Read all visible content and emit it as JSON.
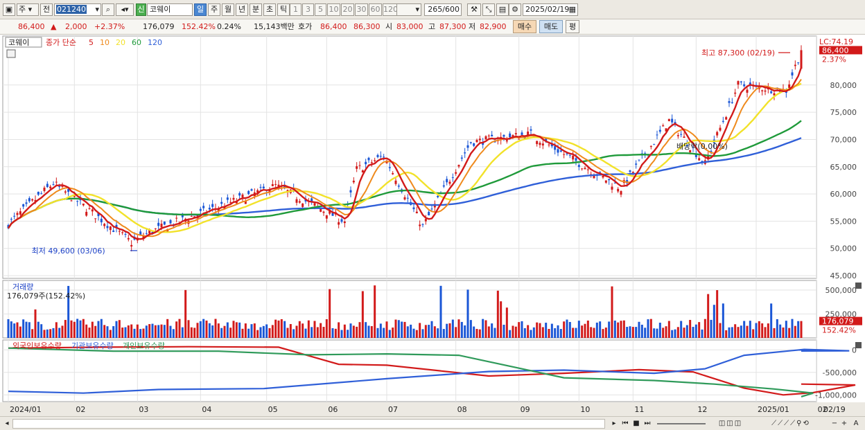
{
  "toolbar": {
    "period_unit": "주",
    "prev_label": "전",
    "stock_code": "021240",
    "market_badge": "신",
    "stock_name": "코웨이",
    "period_buttons": [
      "일",
      "주",
      "월",
      "년",
      "분",
      "초",
      "틱"
    ],
    "active_period": "일",
    "interval_buttons": [
      "1",
      "3",
      "5",
      "10",
      "20",
      "30",
      "60",
      "120"
    ],
    "count_value": "265",
    "count_max": "/600",
    "date_value": "2025/02/19"
  },
  "quote": {
    "price": "86,400",
    "change_arrow": "▲",
    "change": "2,000",
    "change_pct": "+2.37%",
    "volume": "176,079",
    "volume_ratio": "152.42%",
    "turnover": "0.24%",
    "amount": "15,143백만",
    "hoga_label": "호가",
    "ask": "86,400",
    "bid": "86,300",
    "open_label": "시",
    "open": "83,000",
    "high_label": "고",
    "high": "87,300",
    "low_label": "저",
    "low": "82,900",
    "buy_label": "매수",
    "sell_label": "매도",
    "even_label": "평"
  },
  "colors": {
    "up": "#d21a1a",
    "down": "#1a56d6",
    "ma5": "#d21a1a",
    "ma10": "#ef8a1c",
    "ma20": "#f2e22a",
    "ma60": "#1f9a3a",
    "ma120": "#2f5fd8",
    "foreign": "#d21a1a",
    "institution": "#2f5fd8",
    "individual": "#2f9a5a"
  },
  "chart_data": [
    {
      "type": "candlestick",
      "legend_stock": "코웨이",
      "legend_price": "종가 단순",
      "ma_periods": [
        "5",
        "10",
        "20",
        "60",
        "120"
      ],
      "lc_label": "LC:74.19",
      "current_price_tag": "86,400",
      "current_pct_tag": "2.37%",
      "y_ticks": [
        "80,000",
        "75,000",
        "70,000",
        "65,000",
        "60,000",
        "55,000",
        "50,000",
        "45,000"
      ],
      "y_tick_values": [
        80000,
        75000,
        70000,
        65000,
        60000,
        55000,
        50000,
        45000
      ],
      "ylim": [
        44500,
        89000
      ],
      "annotations": {
        "high": "최고 87,300 (02/19)",
        "low": "최저 49,600 (03/06)",
        "dividend": "배당락(0.00%)"
      },
      "key_points": [
        {
          "x": "2024-01-02",
          "close": 54500
        },
        {
          "x": "2024-01-26",
          "close": 62000
        },
        {
          "x": "2024-03-06",
          "low": 49600
        },
        {
          "x": "2024-03-15",
          "close": 53000
        },
        {
          "x": "2024-05-20",
          "close": 61500
        },
        {
          "x": "2024-06-25",
          "close": 55000
        },
        {
          "x": "2024-07-02",
          "close": 64500
        },
        {
          "x": "2024-07-15",
          "close": 67000
        },
        {
          "x": "2024-08-05",
          "close": 54000
        },
        {
          "x": "2024-08-30",
          "close": 69500
        },
        {
          "x": "2024-09-30",
          "close": 71000
        },
        {
          "x": "2024-11-15",
          "close": 61000
        },
        {
          "x": "2024-12-10",
          "close": 73500
        },
        {
          "x": "2024-12-30",
          "close": 65500
        },
        {
          "x": "2025-01-15",
          "close": 80000
        },
        {
          "x": "2025-02-10",
          "close": 79000
        },
        {
          "x": "2025-02-19",
          "open": 83000,
          "high": 87300,
          "low": 82900,
          "close": 86400
        }
      ]
    },
    {
      "type": "bar",
      "title": "거래량",
      "value_label": "176,079주(152.42%)",
      "y_ticks": [
        "500,000",
        "250,000"
      ],
      "y_tick_values": [
        500000,
        250000
      ],
      "ylim": [
        0,
        600000
      ],
      "current_tag": "176,079",
      "current_pct_tag": "152.42%",
      "latest_volume": 176079
    },
    {
      "type": "line",
      "series_names": [
        "외국인보유수량",
        "기관보유수량",
        "개인보유수량"
      ],
      "y_ticks": [
        "0",
        "-500,000",
        "-1,000,000"
      ],
      "y_tick_values": [
        0,
        -500000,
        -1000000
      ],
      "ylim": [
        -1150000,
        220000
      ],
      "x_labels": [
        "2024/01",
        "02",
        "03",
        "04",
        "05",
        "06",
        "07",
        "08",
        "09",
        "10",
        "11",
        "12",
        "2025/01",
        "02"
      ],
      "date_label": "02/19"
    }
  ]
}
